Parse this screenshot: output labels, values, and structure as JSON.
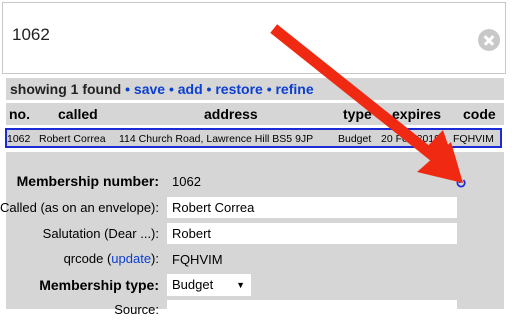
{
  "search": {
    "value": "1062"
  },
  "results": {
    "count_text": "showing 1 found",
    "links": [
      "save",
      "add",
      "restore",
      "refine"
    ],
    "bullet": "•"
  },
  "table": {
    "headers": [
      "no.",
      "called",
      "address",
      "type",
      "expires",
      "code"
    ],
    "row": [
      "1062",
      "Robert Correa",
      "114 Church Road, Lawrence Hill BS5 9JP",
      "Budget",
      "20 Feb 2019",
      "FQHVIM"
    ]
  },
  "form": {
    "membership_number_label": "Membership number:",
    "membership_number_value": "1062",
    "called_label": "Called (as on an envelope):",
    "called_value": "Robert Correa",
    "salutation_label": "Salutation (Dear ...):",
    "salutation_value": "Robert",
    "qrcode_label_pre": "qrcode (",
    "qrcode_update_link": "update",
    "qrcode_label_post": "):",
    "qrcode_value": "FQHVIM",
    "membership_type_label": "Membership type:",
    "membership_type_value": "Budget",
    "source_label": "Source:"
  },
  "colors": {
    "accent": "#0b3fd0",
    "arrow": "#f02a12",
    "selection_border": "#1d2bd6"
  }
}
